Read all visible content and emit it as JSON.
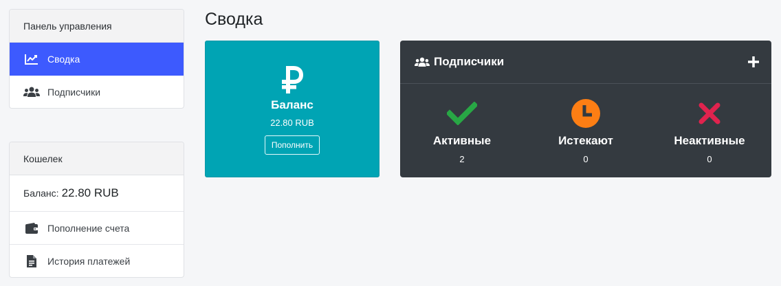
{
  "sidebar": {
    "panel_title": "Панель управления",
    "items": [
      {
        "label": "Сводка",
        "icon": "chart-line-icon",
        "active": true
      },
      {
        "label": "Подписчики",
        "icon": "users-icon",
        "active": false
      }
    ]
  },
  "wallet": {
    "title": "Кошелек",
    "balance_label": "Баланс:",
    "balance_value": "22.80 RUB",
    "actions": [
      {
        "label": "Пополнение счета",
        "icon": "wallet-icon"
      },
      {
        "label": "История платежей",
        "icon": "receipt-icon"
      }
    ]
  },
  "main": {
    "title": "Сводка",
    "balance_card": {
      "icon": "ruble-icon",
      "title": "Баланс",
      "amount": "22.80 RUB",
      "button_label": "Пополнить"
    },
    "subscribers_card": {
      "title": "Подписчики",
      "stats": [
        {
          "label": "Активные",
          "count": "2",
          "icon": "check-icon",
          "color": "#28a745"
        },
        {
          "label": "Истекают",
          "count": "0",
          "icon": "clock-icon",
          "color": "#fd7e14"
        },
        {
          "label": "Неактивные",
          "count": "0",
          "icon": "x-icon",
          "color": "#e0234e"
        }
      ]
    }
  },
  "colors": {
    "background": "#f5f6f8",
    "active_nav": "#3d5afe",
    "balance_card": "#00a4b4",
    "subscribers_card": "#343a40"
  }
}
